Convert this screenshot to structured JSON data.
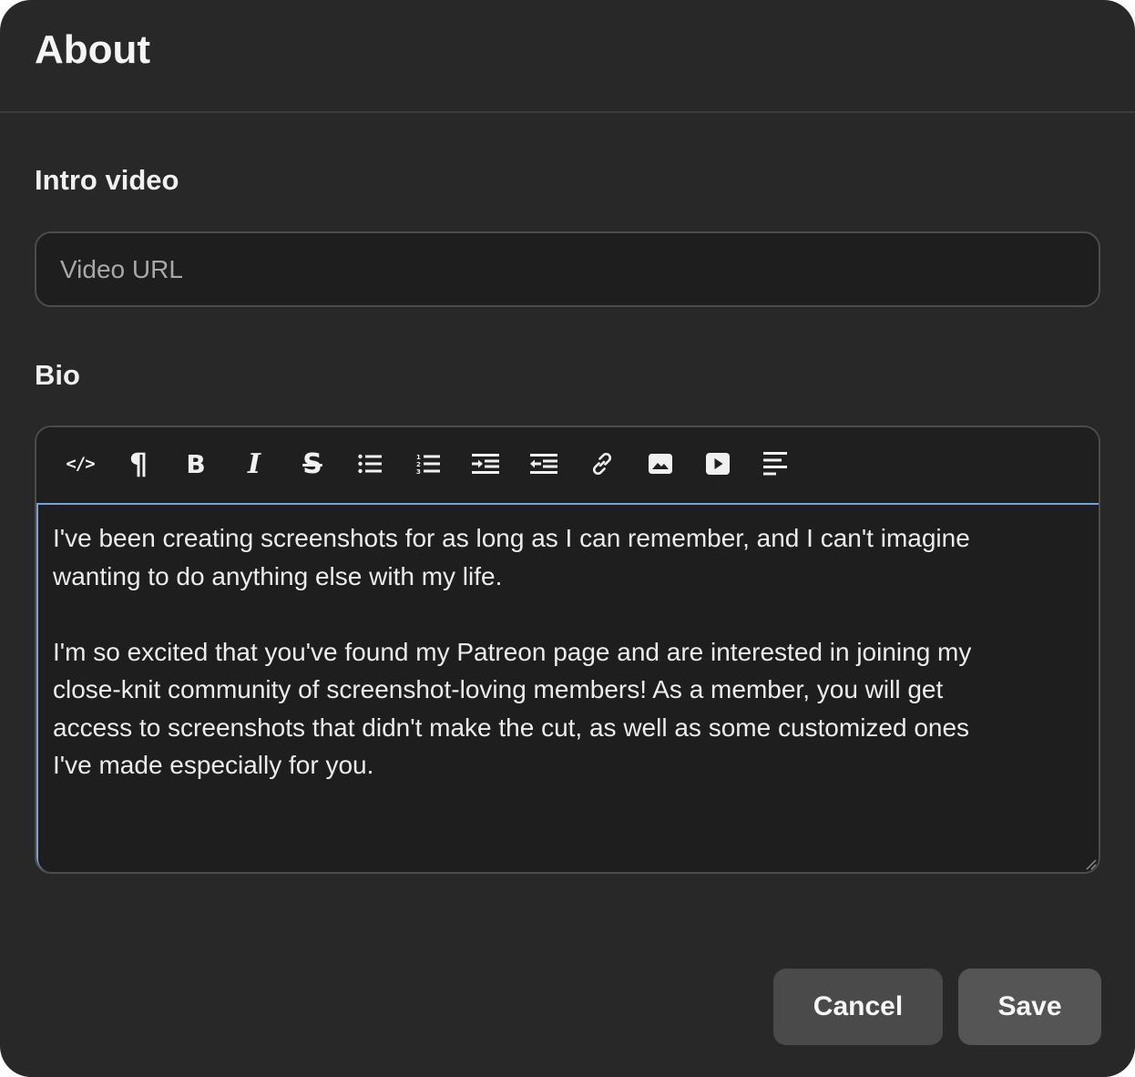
{
  "dialog": {
    "title": "About"
  },
  "intro_video": {
    "label": "Intro video",
    "placeholder": "Video URL",
    "value": ""
  },
  "bio": {
    "label": "Bio",
    "toolbar": [
      {
        "name": "code-icon",
        "label": "</>"
      },
      {
        "name": "paragraph-icon",
        "label": "¶"
      },
      {
        "name": "bold-icon",
        "label": "B"
      },
      {
        "name": "italic-icon",
        "label": "I"
      },
      {
        "name": "strikethrough-icon",
        "label": "S"
      },
      {
        "name": "bullet-list-icon"
      },
      {
        "name": "numbered-list-icon"
      },
      {
        "name": "indent-icon"
      },
      {
        "name": "outdent-icon"
      },
      {
        "name": "link-icon"
      },
      {
        "name": "image-icon"
      },
      {
        "name": "video-icon"
      },
      {
        "name": "align-left-icon"
      }
    ],
    "text": "I've been creating screenshots for as long as I can remember, and I can't imagine\nwanting to do anything else with my life.\n\nI'm so excited that you've found my Patreon page and are interested in joining my\nclose-knit community of screenshot-loving members! As a member, you will get\naccess to screenshots that didn't make the cut, as well as some customized ones\nI've made especially for you."
  },
  "actions": {
    "cancel_label": "Cancel",
    "save_label": "Save"
  },
  "colors": {
    "dialog_bg": "#282828",
    "field_bg": "#1e1e1e",
    "focus_border": "#7d9fd4",
    "button_bg": "#4a4a4a"
  }
}
